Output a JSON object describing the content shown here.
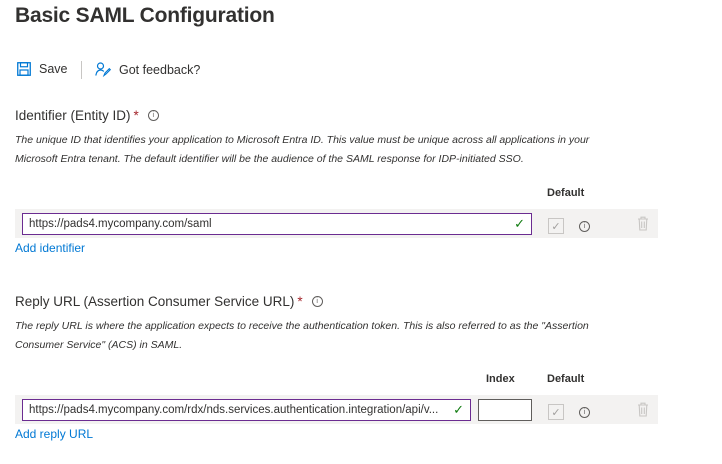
{
  "page": {
    "title": "Basic SAML Configuration"
  },
  "toolbar": {
    "save_label": "Save",
    "feedback_label": "Got feedback?"
  },
  "identifier": {
    "label": "Identifier (Entity ID)",
    "required_mark": "*",
    "info_glyph": "i",
    "description_line1": "The unique ID that identifies your application to Microsoft Entra ID. This value must be unique across all applications in your",
    "description_line2": "Microsoft Entra tenant. The default identifier will be the audience of the SAML response for IDP-initiated SSO.",
    "default_header": "Default",
    "value": "https://pads4.mycompany.com/saml",
    "default_checked": true,
    "add_link": "Add identifier"
  },
  "reply_url": {
    "label": "Reply URL (Assertion Consumer Service URL)",
    "required_mark": "*",
    "info_glyph": "i",
    "description_line1": "The reply URL is where the application expects to receive the authentication token. This is also referred to as the \"Assertion",
    "description_line2": "Consumer Service\" (ACS) in SAML.",
    "index_header": "Index",
    "default_header": "Default",
    "value": "https://pads4.mycompany.com/rdx/nds.services.authentication.integration/api/v...",
    "index_value": "",
    "default_checked": true,
    "add_link": "Add reply URL"
  },
  "icons": {
    "save": "save-icon",
    "feedback": "feedback-icon",
    "info": "info-icon",
    "valid": "checkmark-icon",
    "delete": "trash-icon"
  },
  "colors": {
    "accent": "#0078d4",
    "input_border_active": "#6b2c91",
    "valid": "#107c10",
    "required": "#a4262c"
  }
}
